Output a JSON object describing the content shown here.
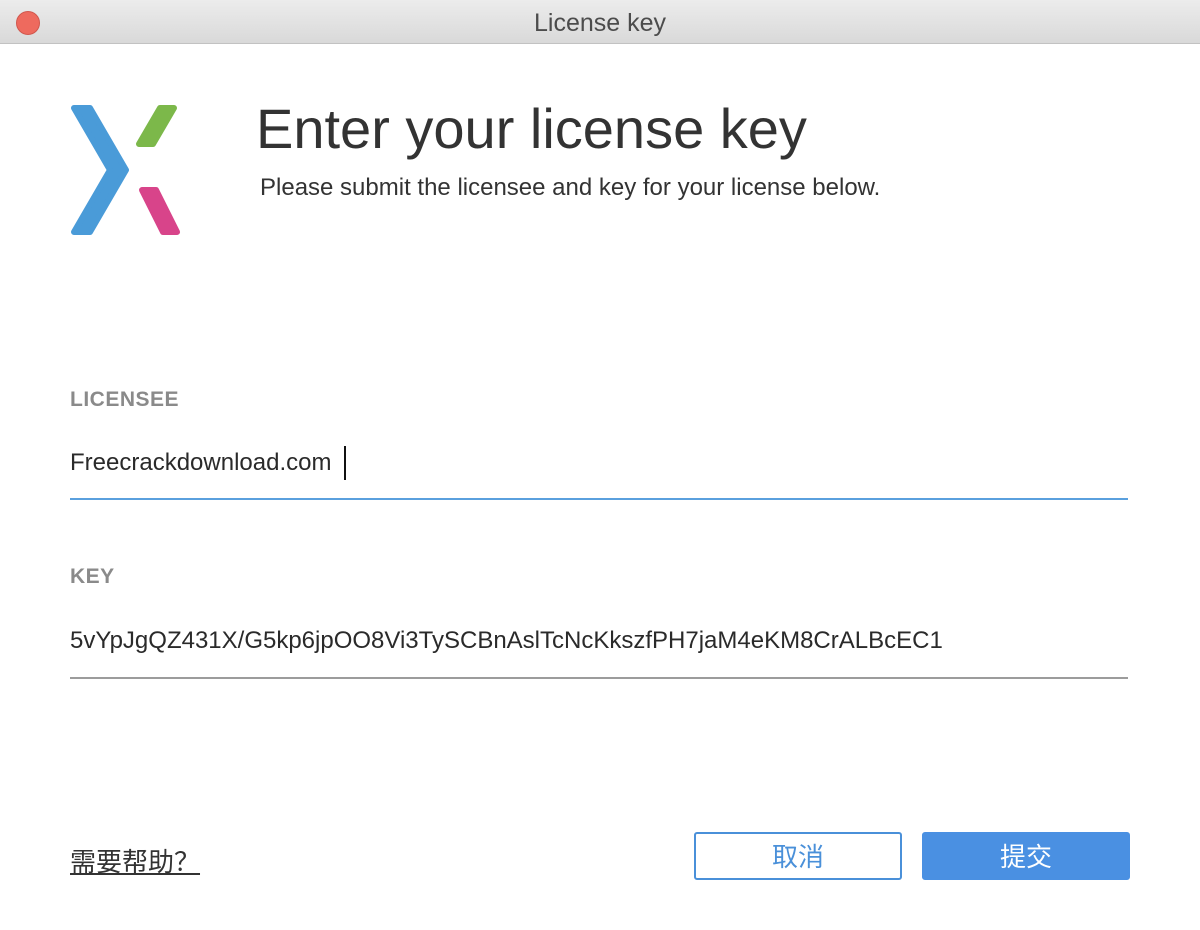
{
  "window": {
    "title": "License key"
  },
  "header": {
    "title": "Enter your license key",
    "subtitle": "Please submit the licensee and key for your license below."
  },
  "logo": {
    "icon": "x-logo-icon",
    "colors": {
      "blue": "#4a9bd8",
      "green": "#7cb84a",
      "pink": "#d8448a"
    }
  },
  "form": {
    "licensee": {
      "label": "LICENSEE",
      "value": "Freecrackdownload.com"
    },
    "key": {
      "label": "KEY",
      "value": "5vYpJgQZ431X/G5kp6jpOO8Vi3TySCBnAslTcNcKkszfPH7jaM4eKM8CrALBcEC1"
    }
  },
  "footer": {
    "help_link": "需要帮助？",
    "cancel_label": "取消",
    "submit_label": "提交"
  },
  "colors": {
    "accent": "#4a90e2",
    "active_underline": "#5aa0de",
    "close_button": "#ee6a5e"
  }
}
